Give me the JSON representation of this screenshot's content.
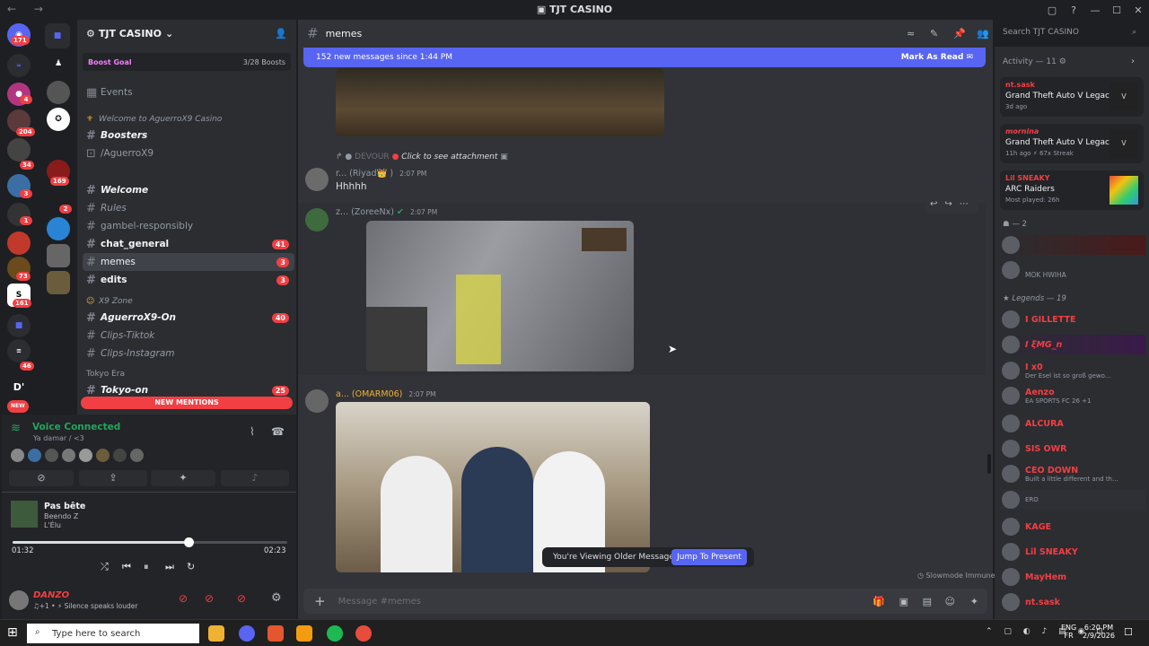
{
  "window": {
    "title": "TJT CASINO",
    "nav": "← →"
  },
  "titlebar_controls": [
    "minimize",
    "maximize",
    "close"
  ],
  "rail": {
    "badges": [
      "171",
      "4",
      "204",
      "34",
      "3",
      "1",
      "169",
      "2",
      "73",
      "161",
      "46"
    ],
    "d_label": "D'",
    "new_label": "NEW"
  },
  "guild": {
    "name": "TJT CASINO",
    "boost_goal": "Boost Goal",
    "boost_count": "3/28 Boosts",
    "events": "Events"
  },
  "channels": [
    {
      "label": "Welcome to AguerroX9 Casino",
      "type": "category"
    },
    {
      "label": "Boosters",
      "type": "channel"
    },
    {
      "label": "/AguerroX9",
      "type": "channel"
    },
    {
      "label": "Welcome",
      "type": "channel"
    },
    {
      "label": "Rules",
      "type": "channel"
    },
    {
      "label": "gambel-responsibly",
      "type": "channel"
    },
    {
      "label": "chat_general",
      "type": "channel",
      "count": "41"
    },
    {
      "label": "memes",
      "type": "channel",
      "count": "3",
      "active": true
    },
    {
      "label": "edits",
      "type": "channel",
      "count": "3"
    },
    {
      "label": "X9 Zone",
      "type": "category"
    },
    {
      "label": "AguerroX9-On",
      "type": "channel",
      "count": "40"
    },
    {
      "label": "Clips-Tiktok",
      "type": "channel"
    },
    {
      "label": "Clips-Instagram",
      "type": "channel"
    },
    {
      "label": "Tokyo Era",
      "type": "category"
    },
    {
      "label": "Tokyo-on",
      "type": "channel",
      "count": "25"
    }
  ],
  "new_mentions": "NEW MENTIONS",
  "voice": {
    "status": "Voice Connected",
    "channel": "Ya damar / <3"
  },
  "music": {
    "title": "Pas bête",
    "artist": "Beendo Z",
    "album": "L'Élu",
    "elapsed": "01:32",
    "total": "02:23",
    "progress": 0.64
  },
  "user": {
    "name": "DANZO",
    "status": "♫+1 • ⚡ Silence speaks louder"
  },
  "chat": {
    "channel": "memes",
    "banner": "152 new messages since 1:44 PM",
    "mark_read": "Mark As Read",
    "messages": [
      {
        "attach_prefix": "DEVOUR",
        "attach": "Click to see attachment",
        "author": "r... (Riyad👑 )",
        "time": "2:07 PM",
        "text": "Hhhhh"
      },
      {
        "author": "z... (ZoreeNx)",
        "time": "2:07 PM"
      },
      {
        "author": "a... (OMARM06)",
        "time": "2:07 PM"
      }
    ],
    "older_notice": "You're Viewing Older Messages",
    "jump": "Jump To Present",
    "slowmode": "Slowmode Immune",
    "composer_placeholder": "Message #memes"
  },
  "header_search": "Search TJT CASINO",
  "activity": {
    "header": "Activity — 11",
    "cards": [
      {
        "user": "nt.sask",
        "game": "Grand Theft Auto V Legacy",
        "meta": "3d ago"
      },
      {
        "user": "mornina",
        "game": "Grand Theft Auto V Legacy",
        "meta": "11h ago  ⚡ 67x Streak"
      },
      {
        "user": "Lil SNEAKY",
        "game": "ARC Raiders",
        "meta": "Most played: 26h"
      }
    ],
    "group2": "— 2",
    "group2_members": [
      "",
      "MOK HWIHA"
    ],
    "legends_header": "Legends — 19",
    "legends": [
      {
        "name": "I GILLETTE",
        "sub": ""
      },
      {
        "name": "I ξMG_n",
        "sub": ""
      },
      {
        "name": "I x0",
        "sub": "Der Esel ist so groß gewo..."
      },
      {
        "name": "Aenzo",
        "sub": "EA SPORTS FC 26 +1"
      },
      {
        "name": "ALCURA",
        "sub": ""
      },
      {
        "name": "SIS OWR",
        "sub": ""
      },
      {
        "name": "CEO DOWN",
        "sub": "Built a little different and th..."
      },
      {
        "name": "",
        "sub": "ERO"
      },
      {
        "name": "KAGE",
        "sub": ""
      },
      {
        "name": "Lil SNEAKY",
        "sub": ""
      },
      {
        "name": "MayHem",
        "sub": ""
      },
      {
        "name": "nt.sask",
        "sub": ""
      }
    ]
  },
  "taskbar": {
    "search": "Type here to search",
    "lang": "ENG",
    "layout": "FR",
    "time": "6:20 PM",
    "date": "2/9/2026"
  },
  "colors": {
    "accent": "#5865f2",
    "red": "#f23f43",
    "bg": "#313338",
    "sidebar": "#2b2d31"
  }
}
